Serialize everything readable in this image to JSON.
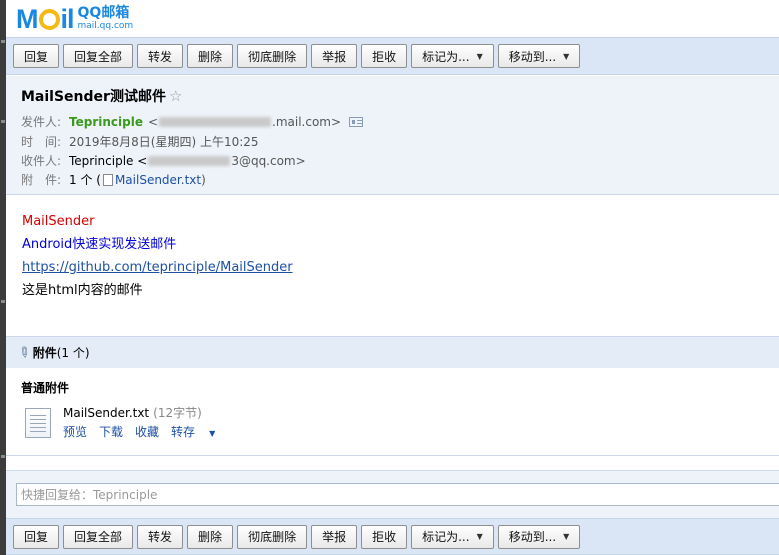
{
  "logo": {
    "brand": "Mail",
    "cn_name": "QQ邮箱",
    "url": "mail.qq.com"
  },
  "toolbar": {
    "buttons": [
      {
        "label": "回复",
        "dropdown": false
      },
      {
        "label": "回复全部",
        "dropdown": false
      },
      {
        "label": "转发",
        "dropdown": false
      },
      {
        "label": "删除",
        "dropdown": false
      },
      {
        "label": "彻底删除",
        "dropdown": false
      },
      {
        "label": "举报",
        "dropdown": false
      },
      {
        "label": "拒收",
        "dropdown": false
      },
      {
        "label": "标记为...",
        "dropdown": true
      },
      {
        "label": "移动到...",
        "dropdown": true
      }
    ]
  },
  "mail": {
    "subject": "MailSender测试邮件",
    "from_label": "发件人:",
    "from_name": "Teprinciple",
    "from_email_prefix": "<",
    "from_email_suffix": ".mail.com>",
    "time_label": "时　间:",
    "time_value": "2019年8月8日(星期四) 上午10:25",
    "to_label": "收件人:",
    "to_name": "Teprinciple <",
    "to_email_suffix": "3@qq.com>",
    "att_label": "附　件:",
    "att_count": "1 个 (",
    "att_link": "MailSender.txt",
    "att_close": ")"
  },
  "body": {
    "line1": "MailSender",
    "line2": "Android快速实现发送邮件",
    "line3": "https://github.com/teprinciple/MailSender",
    "line4": "这是html内容的邮件"
  },
  "attachments": {
    "header_title": "附件",
    "header_count": "(1 个)",
    "section_title": "普通附件",
    "file_name": "MailSender.txt",
    "file_size": "(12字节)",
    "actions": [
      "预览",
      "下载",
      "收藏",
      "转存"
    ]
  },
  "quick_reply": {
    "placeholder": "快捷回复给：Teprinciple"
  },
  "colors": {
    "toolbar_bg": "#dae6f5",
    "header_bg": "#eef3fa",
    "sender_green": "#3a9a1e",
    "link_blue": "#1e50a2",
    "body_red": "#d40000",
    "body_blue": "#0000d8"
  }
}
